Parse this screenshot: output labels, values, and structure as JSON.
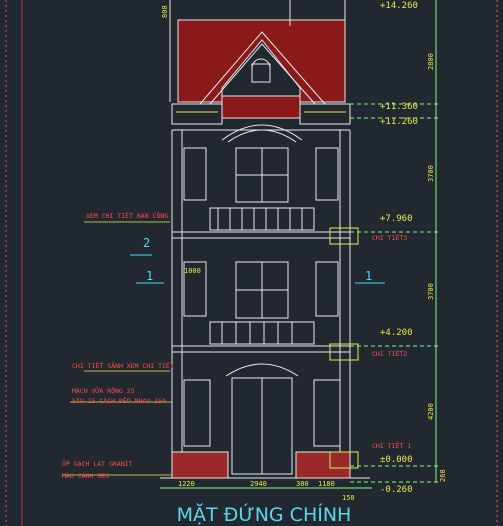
{
  "title": "MẶT ĐỨNG CHÍNH",
  "colors": {
    "background": "#222830",
    "roof": "#8a1a1a",
    "brick": "#9a2a2a",
    "lines": "#e8e8e8",
    "dim_green": "#7cff7c",
    "dim_yellow": "#e8e84a",
    "marker_cyan": "#4ad8ff",
    "annotation_red": "#ff4a4a",
    "title_cyan": "#5ad8e8"
  },
  "levels": [
    {
      "label": "+14.260"
    },
    {
      "label": "+11.360"
    },
    {
      "label": "+11.260"
    },
    {
      "label": "+7.960"
    },
    {
      "label": "+4.200"
    },
    {
      "label": "±0.000"
    },
    {
      "label": "-0.260"
    }
  ],
  "vertical_dims": [
    "2800",
    "3700",
    "3700",
    "4200",
    "260"
  ],
  "bottom_dims": [
    "1220",
    "2940",
    "300",
    "1180",
    "150"
  ],
  "roof_dim": "800",
  "window_dim": "1000",
  "axis_labels": [
    "2",
    "1",
    "1"
  ],
  "annotations": {
    "balcony_detail": "XEM CHI TIẾT BAN CÔNG",
    "canopy_detail": "CHI TIẾT SẢNH XEM CHI TIẾT",
    "mortar_line1": "MẠCH VỮA RỘNG 25",
    "mortar_line2": "SÂU 15 CÁCH ĐỀU NHAU 350",
    "tile_line1": "ỐP GẠCH LÁT GRANIT",
    "tile_line2": "MÀU CÁNH SEN",
    "detail3": "CHI TIẾT3",
    "detail2": "CHI TIẾT2",
    "detail1": "CHI TIẾT 1"
  }
}
